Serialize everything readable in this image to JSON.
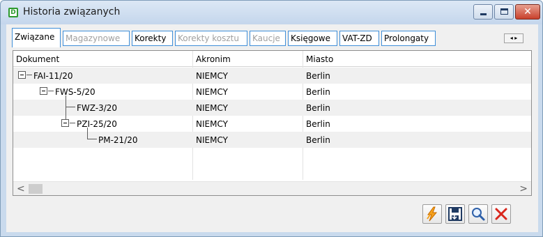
{
  "window": {
    "title": "Historia związanych",
    "app_icon_letter": "D",
    "controls": {
      "minimize": "minimize-icon",
      "maximize": "maximize-icon",
      "close": "close-icon",
      "close_glyph": "✕"
    }
  },
  "tabs": [
    {
      "label": "Związane",
      "state": "active"
    },
    {
      "label": "Magazynowe",
      "state": "disabled"
    },
    {
      "label": "Korekty",
      "state": "enabled"
    },
    {
      "label": "Korekty kosztu",
      "state": "disabled"
    },
    {
      "label": "Kaucje",
      "state": "disabled"
    },
    {
      "label": "Księgowe",
      "state": "enabled"
    },
    {
      "label": "VAT-ZD",
      "state": "enabled"
    },
    {
      "label": "Prolongaty",
      "state": "enabled"
    }
  ],
  "tab_scroll": {
    "left": "◂",
    "right": "▸"
  },
  "grid": {
    "columns": [
      "Dokument",
      "Akronim",
      "Miasto"
    ],
    "rows": [
      {
        "dokument": "FAI-11/20",
        "akronim": "NIEMCY",
        "miasto": "Berlin",
        "level": 0,
        "expanded": true
      },
      {
        "dokument": "FWS-5/20",
        "akronim": "NIEMCY",
        "miasto": "Berlin",
        "level": 1,
        "expanded": true
      },
      {
        "dokument": "FWZ-3/20",
        "akronim": "NIEMCY",
        "miasto": "Berlin",
        "level": 2,
        "expanded": false
      },
      {
        "dokument": "PZI-25/20",
        "akronim": "NIEMCY",
        "miasto": "Berlin",
        "level": 2,
        "expanded": true
      },
      {
        "dokument": "PM-21/20",
        "akronim": "NIEMCY",
        "miasto": "Berlin",
        "level": 3,
        "expanded": false
      }
    ],
    "scroll": {
      "left": "<",
      "right": ">"
    }
  },
  "buttons": [
    {
      "name": "run-button",
      "icon": "lightning-icon",
      "color": "#f7a21b"
    },
    {
      "name": "save-button",
      "icon": "save-icon",
      "color": "#1f3a62"
    },
    {
      "name": "search-button",
      "icon": "magnifier-icon",
      "color": "#2d5fa8"
    },
    {
      "name": "close-button",
      "icon": "close-x-icon",
      "color": "#d9261c"
    }
  ]
}
